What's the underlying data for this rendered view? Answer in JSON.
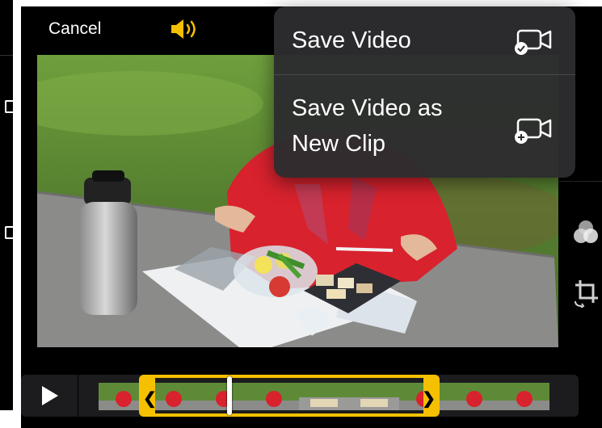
{
  "topbar": {
    "cancel_label": "Cancel",
    "speaker_icon": "speaker-icon",
    "accent_color": "#f5c000"
  },
  "menu": {
    "items": [
      {
        "label": "Save Video",
        "icon": "save-video-icon"
      },
      {
        "label_lines": [
          "Save Video as",
          "New Clip"
        ],
        "icon": "save-new-clip-icon"
      }
    ]
  },
  "tools": {
    "filters_icon": "filters-icon",
    "crop_icon": "crop-rotate-icon"
  },
  "timeline": {
    "play_icon": "play-icon",
    "trim_start_glyph": "❮",
    "trim_end_glyph": "❯"
  }
}
